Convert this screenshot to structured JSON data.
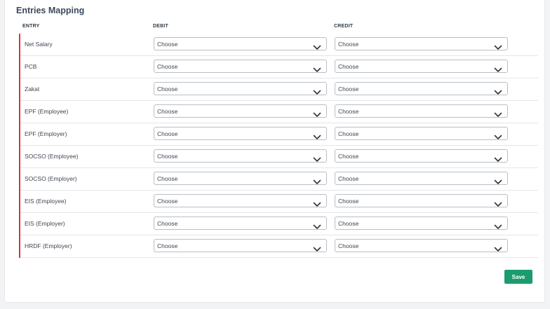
{
  "section_title": "Entries Mapping",
  "columns": {
    "entry": "ENTRY",
    "debit": "DEBIT",
    "credit": "CREDIT"
  },
  "icons": {
    "dropdown": "chevron-down-icon"
  },
  "colors": {
    "accent_border": "#d9323f",
    "save_button": "#1c9c6e"
  },
  "rows": [
    {
      "entry": "Net Salary",
      "debit": "Choose",
      "credit": "Choose"
    },
    {
      "entry": "PCB",
      "debit": "Choose",
      "credit": "Choose"
    },
    {
      "entry": "Zakat",
      "debit": "Choose",
      "credit": "Choose"
    },
    {
      "entry": "EPF (Employee)",
      "debit": "Choose",
      "credit": "Choose"
    },
    {
      "entry": "EPF (Employer)",
      "debit": "Choose",
      "credit": "Choose"
    },
    {
      "entry": "SOCSO (Employee)",
      "debit": "Choose",
      "credit": "Choose"
    },
    {
      "entry": "SOCSO (Employer)",
      "debit": "Choose",
      "credit": "Choose"
    },
    {
      "entry": "EIS (Employee)",
      "debit": "Choose",
      "credit": "Choose"
    },
    {
      "entry": "EIS (Employer)",
      "debit": "Choose",
      "credit": "Choose"
    },
    {
      "entry": "HRDF (Employer)",
      "debit": "Choose",
      "credit": "Choose"
    }
  ],
  "actions": {
    "save_label": "Save"
  }
}
